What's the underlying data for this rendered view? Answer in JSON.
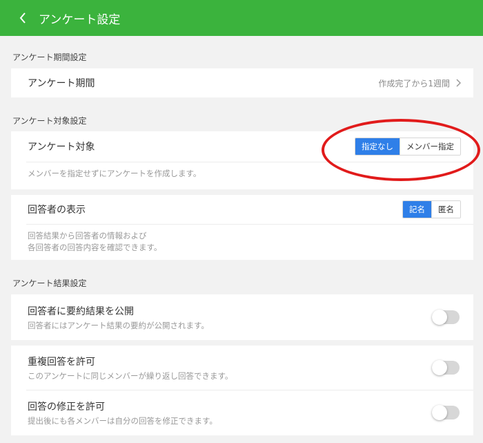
{
  "header": {
    "title": "アンケート設定",
    "back_icon": "chevron-left-icon"
  },
  "period_section": {
    "label": "アンケート期間設定",
    "row_title": "アンケート期間",
    "row_value": "作成完了から1週間"
  },
  "target_section": {
    "label": "アンケート対象設定",
    "target": {
      "title": "アンケート対象",
      "options": [
        "指定なし",
        "メンバー指定"
      ],
      "selected": "指定なし",
      "description": "メンバーを指定せずにアンケートを作成します。"
    },
    "respondent": {
      "title": "回答者の表示",
      "options": [
        "記名",
        "匿名"
      ],
      "selected": "記名",
      "description_line1": "回答結果から回答者の情報および",
      "description_line2": "各回答者の回答内容を確認できます。"
    }
  },
  "result_section": {
    "label": "アンケート結果設定",
    "toggles": [
      {
        "title": "回答者に要約結果を公開",
        "subtitle": "回答者にはアンケート結果の要約が公開されます。",
        "on": false
      },
      {
        "title": "重複回答を許可",
        "subtitle": "このアンケートに同じメンバーが繰り返し回答できます。",
        "on": false
      },
      {
        "title": "回答の修正を許可",
        "subtitle": "提出後にも各メンバーは自分の回答を修正できます。",
        "on": false
      }
    ]
  },
  "colors": {
    "header": "#3bb33d",
    "accent": "#2f7fe8",
    "annotation": "#e11b1b"
  }
}
